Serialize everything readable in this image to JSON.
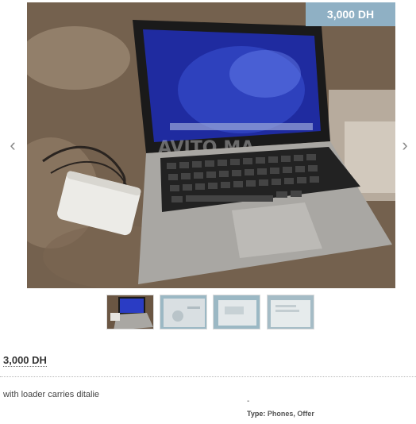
{
  "gallery": {
    "main_image": "macbook-laptop-photo",
    "price_badge": "3,000 DH",
    "prev_icon": "‹",
    "next_icon": "›",
    "watermark": "AVITO.MA",
    "thumbnails": [
      {
        "image": "laptop-photo",
        "selected": true
      },
      {
        "image": "document-photo",
        "selected": false
      },
      {
        "image": "document-photo",
        "selected": false
      },
      {
        "image": "document-photo",
        "selected": false
      }
    ]
  },
  "listing": {
    "price": "3,000 DH",
    "description": "with loader carries ditalie",
    "dash": "-",
    "type_label": "Type:",
    "type_value": "Phones, Offer"
  },
  "colors": {
    "badge": "#8fb0c4",
    "photo_bg": "#3a2f26",
    "screen_blue": "#2430a8"
  }
}
